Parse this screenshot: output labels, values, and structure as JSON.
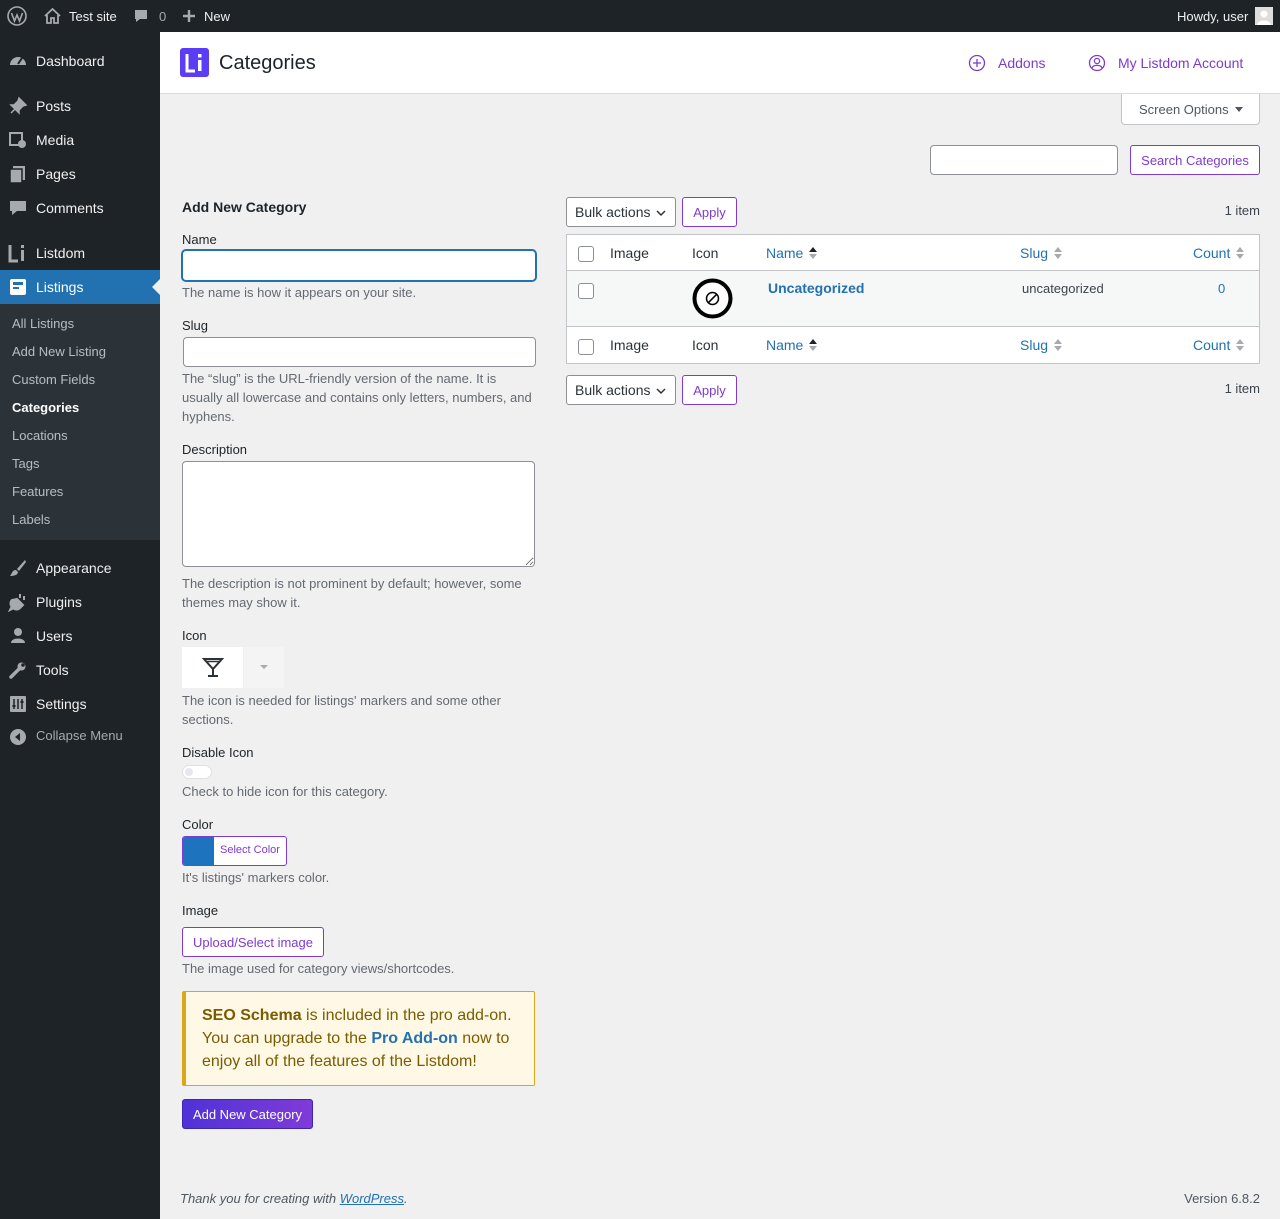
{
  "admin_bar": {
    "site_name": "Test site",
    "comments_count": "0",
    "new_label": "New",
    "greeting": "Howdy, user"
  },
  "sidebar": {
    "items": [
      {
        "label": "Dashboard",
        "icon": "dashboard-icon"
      },
      {
        "label": "Posts",
        "icon": "pin-icon"
      },
      {
        "label": "Media",
        "icon": "media-icon"
      },
      {
        "label": "Pages",
        "icon": "pages-icon"
      },
      {
        "label": "Comments",
        "icon": "comment-icon"
      },
      {
        "label": "Listdom",
        "icon": "listdom-icon"
      },
      {
        "label": "Listings",
        "icon": "listings-icon"
      },
      {
        "label": "Appearance",
        "icon": "brush-icon"
      },
      {
        "label": "Plugins",
        "icon": "plugin-icon"
      },
      {
        "label": "Users",
        "icon": "user-icon"
      },
      {
        "label": "Tools",
        "icon": "wrench-icon"
      },
      {
        "label": "Settings",
        "icon": "settings-icon"
      }
    ],
    "submenu": [
      "All Listings",
      "Add New Listing",
      "Custom Fields",
      "Categories",
      "Locations",
      "Tags",
      "Features",
      "Labels"
    ],
    "collapse_label": "Collapse Menu"
  },
  "header": {
    "title": "Categories",
    "addons_label": "Addons",
    "account_label": "My Listdom Account"
  },
  "screen_options_label": "Screen Options",
  "search": {
    "button_label": "Search Categories",
    "value": ""
  },
  "form": {
    "heading": "Add New Category",
    "name_label": "Name",
    "name_desc": "The name is how it appears on your site.",
    "slug_label": "Slug",
    "slug_desc": "The “slug” is the URL-friendly version of the name. It is usually all lowercase and contains only letters, numbers, and hyphens.",
    "description_label": "Description",
    "description_desc": "The description is not prominent by default; however, some themes may show it.",
    "icon_label": "Icon",
    "icon_desc": "The icon is needed for listings' markers and some other sections.",
    "disable_icon_label": "Disable Icon",
    "disable_icon_desc": "Check to hide icon for this category.",
    "color_label": "Color",
    "color_button_label": "Select Color",
    "color_value": "#1e73be",
    "color_desc": "It's listings' markers color.",
    "image_label": "Image",
    "image_button_label": "Upload/Select image",
    "image_desc": "The image used for category views/shortcodes.",
    "notice_bold": "SEO Schema",
    "notice_text1": " is included in the pro add-on. You can upgrade to the ",
    "notice_link": "Pro Add-on",
    "notice_text2": " now to enjoy all of the features of the Listdom!",
    "submit_label": "Add New Category"
  },
  "table": {
    "bulk_actions_label": "Bulk actions",
    "apply_label": "Apply",
    "items_count": "1 item",
    "columns": [
      "Image",
      "Icon",
      "Name",
      "Slug",
      "Count"
    ],
    "rows": [
      {
        "name": "Uncategorized",
        "slug": "uncategorized",
        "count": "0",
        "icon": "ban-icon"
      }
    ]
  },
  "footer": {
    "thanks_text": "Thank you for creating with ",
    "wordpress_link": "WordPress",
    "period": ".",
    "version": "Version 6.8.2"
  },
  "colors": {
    "accent": "#7e3bd0",
    "wp_blue": "#2271b1",
    "sidebar_bg": "#1d2327"
  }
}
